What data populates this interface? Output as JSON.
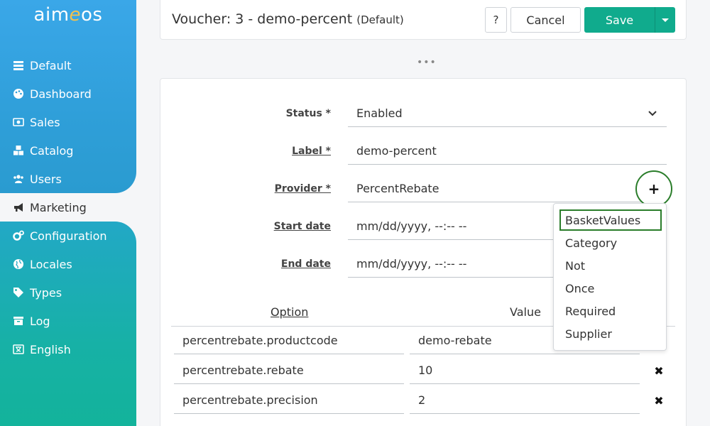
{
  "app": {
    "logo": "aimeos"
  },
  "sidebar": {
    "items": [
      {
        "label": "Default",
        "icon": "list-icon"
      },
      {
        "label": "Dashboard",
        "icon": "palette-icon"
      },
      {
        "label": "Sales",
        "icon": "money-icon"
      },
      {
        "label": "Catalog",
        "icon": "cubes-icon"
      },
      {
        "label": "Users",
        "icon": "users-icon"
      },
      {
        "label": "Marketing",
        "icon": "megaphone-icon",
        "active": true
      },
      {
        "label": "Configuration",
        "icon": "gears-icon"
      },
      {
        "label": "Locales",
        "icon": "globe-icon"
      },
      {
        "label": "Types",
        "icon": "tag-icon"
      },
      {
        "label": "Log",
        "icon": "archive-icon"
      },
      {
        "label": "English",
        "icon": "language-icon"
      }
    ]
  },
  "header": {
    "title": "Voucher: 3 - demo-percent",
    "site": "(Default)",
    "help_label": "?",
    "cancel_label": "Cancel",
    "save_label": "Save"
  },
  "form": {
    "status": {
      "label": "Status *",
      "value": "Enabled"
    },
    "label": {
      "label": "Label *",
      "value": "demo-percent"
    },
    "provider": {
      "label": "Provider *",
      "value": "PercentRebate",
      "add_label": "+"
    },
    "start_date": {
      "label": "Start date",
      "placeholder": "mm/dd/yyyy, --:-- --"
    },
    "end_date": {
      "label": "End date",
      "placeholder": "mm/dd/yyyy, --:-- --"
    }
  },
  "options": {
    "headers": {
      "option": "Option",
      "value": "Value"
    },
    "rows": [
      {
        "option": "percentrebate.productcode",
        "value": "demo-rebate"
      },
      {
        "option": "percentrebate.rebate",
        "value": "10"
      },
      {
        "option": "percentrebate.precision",
        "value": "2"
      }
    ]
  },
  "decorator_menu": {
    "items": [
      "BasketValues",
      "Category",
      "Not",
      "Once",
      "Required",
      "Supplier"
    ],
    "selected": "BasketValues"
  },
  "colors": {
    "primary": "#10ab8d",
    "sidebar_blue": "#2f9fd9",
    "sidebar_teal": "#13b39b",
    "focus_outline": "#2a7d2a"
  }
}
